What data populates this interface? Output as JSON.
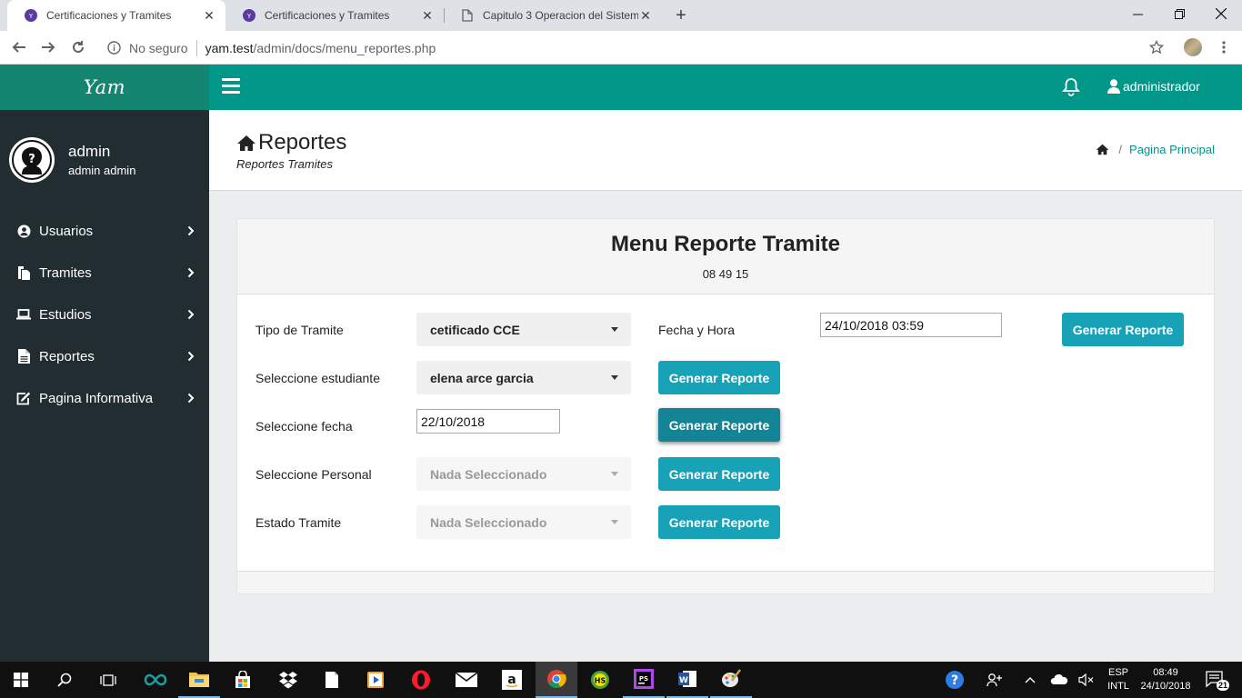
{
  "browser": {
    "tabs": [
      {
        "title": "Certificaciones y Tramites",
        "active": true,
        "icon": "site-favicon"
      },
      {
        "title": "Certificaciones y Tramites",
        "active": false,
        "icon": "site-favicon"
      },
      {
        "title": "Capitulo 3 Operacion del Sistema",
        "active": false,
        "icon": "document-icon"
      }
    ],
    "security_label": "No seguro",
    "url_host": "yam.test",
    "url_path": "/admin/docs/menu_reportes.php"
  },
  "app": {
    "logo": "Yam",
    "user_label": "administrador",
    "accent": "#009688",
    "sidebar_bg": "#222d32"
  },
  "sidebar": {
    "profile_name": "admin",
    "profile_sub": "admin admin",
    "items": [
      {
        "label": "Usuarios",
        "icon": "user-circle-icon"
      },
      {
        "label": "Tramites",
        "icon": "files-icon"
      },
      {
        "label": "Estudios",
        "icon": "laptop-icon"
      },
      {
        "label": "Reportes",
        "icon": "file-text-icon"
      },
      {
        "label": "Pagina Informativa",
        "icon": "edit-icon"
      }
    ]
  },
  "page": {
    "title": "Reportes",
    "subtitle": "Reportes Tramites",
    "breadcrumb": "Pagina Principal"
  },
  "card": {
    "title": "Menu Reporte Tramite",
    "clock": "08 49 15",
    "rows": [
      {
        "label": "Tipo de Tramite",
        "control": "select",
        "value": "cetificado CCE",
        "button": "Generar Reporte"
      },
      {
        "label": "Seleccione estudiante",
        "control": "select",
        "value": "elena arce garcia",
        "button": "Generar Reporte"
      },
      {
        "label": "Seleccione fecha",
        "control": "date",
        "value": "22/10/2018",
        "button": "Generar Reporte"
      },
      {
        "label": "Seleccione Personal",
        "control": "select",
        "value": "Nada Seleccionado",
        "disabled": true,
        "button": "Generar Reporte"
      },
      {
        "label": "Estado Tramite",
        "control": "select",
        "value": "Nada Seleccionado",
        "disabled": true,
        "button": "Generar Reporte"
      }
    ],
    "datetime_label": "Fecha y Hora",
    "datetime_value": "24/10/2018 03:59",
    "datetime_button": "Generar Reporte"
  },
  "taskbar": {
    "lang_top": "ESP",
    "lang_bottom": "INTL",
    "time": "08:49",
    "date": "24/10/2018",
    "notifications": "21"
  }
}
